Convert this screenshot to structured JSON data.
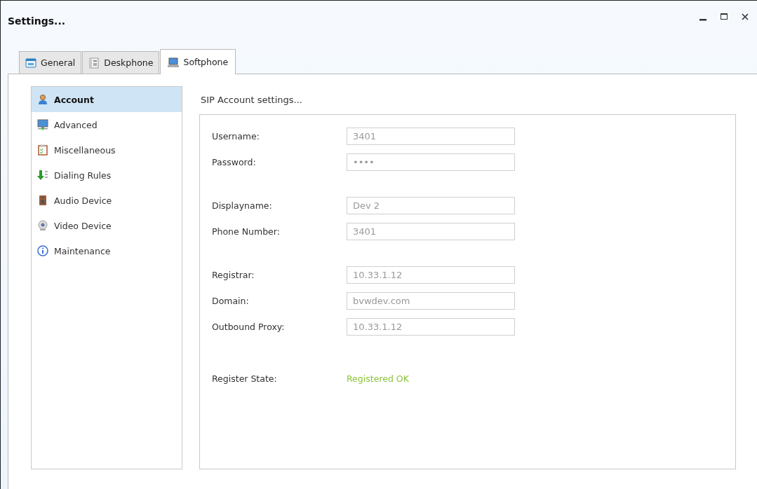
{
  "window": {
    "title": "Settings..."
  },
  "tabs": [
    {
      "label": "General",
      "selected": false
    },
    {
      "label": "Deskphone",
      "selected": false
    },
    {
      "label": "Softphone",
      "selected": true
    }
  ],
  "sidebar": {
    "items": [
      {
        "label": "Account",
        "selected": true
      },
      {
        "label": "Advanced",
        "selected": false
      },
      {
        "label": "Miscellaneous",
        "selected": false
      },
      {
        "label": "Dialing Rules",
        "selected": false
      },
      {
        "label": "Audio Device",
        "selected": false
      },
      {
        "label": "Video Device",
        "selected": false
      },
      {
        "label": "Maintenance",
        "selected": false
      }
    ]
  },
  "panel": {
    "heading": "SIP Account settings...",
    "groups": [
      [
        {
          "kind": "field",
          "label": "Username:",
          "value": "3401"
        },
        {
          "kind": "field",
          "label": "Password:",
          "value": "••••"
        }
      ],
      [
        {
          "kind": "field",
          "label": "Displayname:",
          "value": "Dev 2"
        },
        {
          "kind": "field",
          "label": "Phone Number:",
          "value": "3401"
        }
      ],
      [
        {
          "kind": "field",
          "label": "Registrar:",
          "value": "10.33.1.12"
        },
        {
          "kind": "field",
          "label": "Domain:",
          "value": "bvwdev.com"
        },
        {
          "kind": "field",
          "label": "Outbound Proxy:",
          "value": "10.33.1.12"
        }
      ],
      [
        {
          "kind": "status",
          "label": "Register State:",
          "value": "Registered OK"
        }
      ]
    ]
  }
}
